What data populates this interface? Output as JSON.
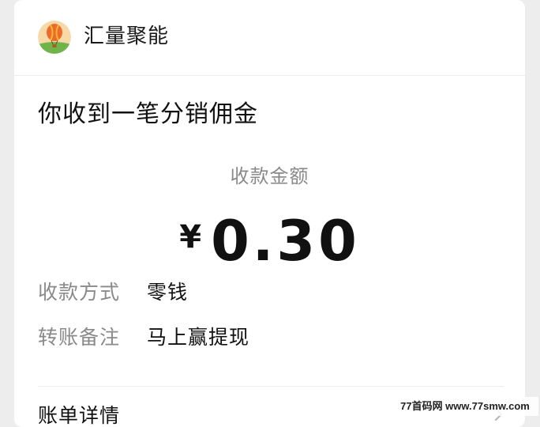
{
  "header": {
    "app_name": "汇量聚能",
    "avatar_icon": "hot-air-balloon-icon"
  },
  "message": {
    "title": "你收到一笔分销佣金",
    "amount_label": "收款金额",
    "currency": "¥",
    "amount": "0.30"
  },
  "details": [
    {
      "key": "收款方式",
      "value": "零钱"
    },
    {
      "key": "转账备注",
      "value": "马上赢提现"
    }
  ],
  "footer": {
    "bill_details_label": "账单详情",
    "chevron_icon": "chevron-right-icon"
  },
  "watermark": "77首码网 www.77smw.com",
  "colors": {
    "background": "#ededed",
    "card": "#ffffff",
    "primary_text": "#111111",
    "secondary_text": "#8a8a8a"
  }
}
